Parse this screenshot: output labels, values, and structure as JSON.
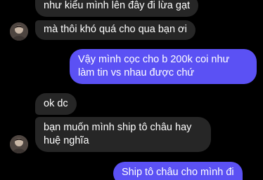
{
  "messages": [
    {
      "side": "incoming",
      "text": "như kiểu mình lên đây đi lừa gạt"
    },
    {
      "side": "incoming",
      "text": "mà thôi khó quá cho qua bạn ơi"
    },
    {
      "side": "outgoing",
      "text": "Vậy mình cọc cho b 200k coi như làm tin vs nhau được chứ"
    },
    {
      "side": "incoming",
      "text": "ok dc"
    },
    {
      "side": "incoming",
      "text": "bạn muốn mình ship tô châu hay huệ nghĩa"
    },
    {
      "side": "outgoing",
      "text": "Ship tô châu cho mình đi"
    }
  ],
  "colors": {
    "background": "#000000",
    "incoming_bubble": "#262626",
    "outgoing_bubble": "#5b51f4",
    "text": "#ffffff"
  },
  "avatar_icon": "contact-avatar-photo"
}
